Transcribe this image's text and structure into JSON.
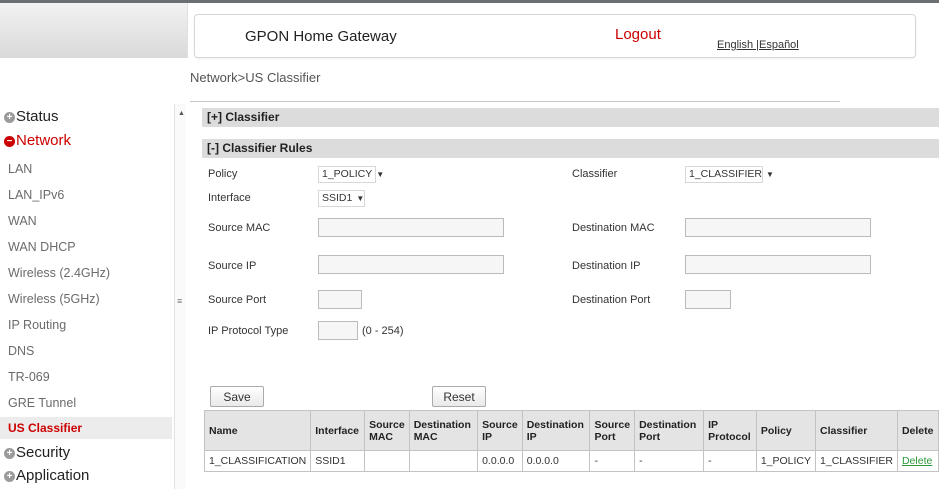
{
  "header": {
    "title": "GPON Home Gateway",
    "logout": "Logout",
    "language": "English |Español"
  },
  "breadcrumb": "Network>US Classifier",
  "sidebar": {
    "status": "Status",
    "network": "Network",
    "network_items": [
      "LAN",
      "LAN_IPv6",
      "WAN",
      "WAN DHCP",
      "Wireless (2.4GHz)",
      "Wireless (5GHz)",
      "IP Routing",
      "DNS",
      "TR-069",
      "GRE Tunnel",
      "US Classifier"
    ],
    "security": "Security",
    "application": "Application",
    "bullet_expanded": "−",
    "bullet_collapsed": "+"
  },
  "sections": {
    "classifier": "[+] Classifier",
    "classifier_rules": "[-] Classifier Rules"
  },
  "form": {
    "policy_label": "Policy",
    "policy_value": "1_POLICY",
    "classifier_label": "Classifier",
    "classifier_value": "1_CLASSIFIER",
    "interface_label": "Interface",
    "interface_value": "SSID1",
    "source_mac_label": "Source MAC",
    "destination_mac_label": "Destination MAC",
    "source_ip_label": "Source IP",
    "destination_ip_label": "Destination IP",
    "source_port_label": "Source Port",
    "destination_port_label": "Destination Port",
    "ip_protocol_label": "IP Protocol Type",
    "ip_protocol_hint": "(0 - 254)",
    "save": "Save",
    "reset": "Reset"
  },
  "table": {
    "headers": [
      "Name",
      "Interface",
      "Source MAC",
      "Destination MAC",
      "Source IP",
      "Destination IP",
      "Source Port",
      "Destination Port",
      "IP Protocol",
      "Policy",
      "Classifier",
      "Delete"
    ],
    "rows": [
      [
        "1_CLASSIFICATION",
        "SSID1",
        "",
        "",
        "0.0.0.0",
        "0.0.0.0",
        "-",
        "-",
        "-",
        "1_POLICY",
        "1_CLASSIFIER",
        "Delete"
      ]
    ]
  },
  "colors": {
    "accent": "#cc0000",
    "section_bar": "#dcdcdc",
    "delete_link": "#2a9a3a"
  }
}
